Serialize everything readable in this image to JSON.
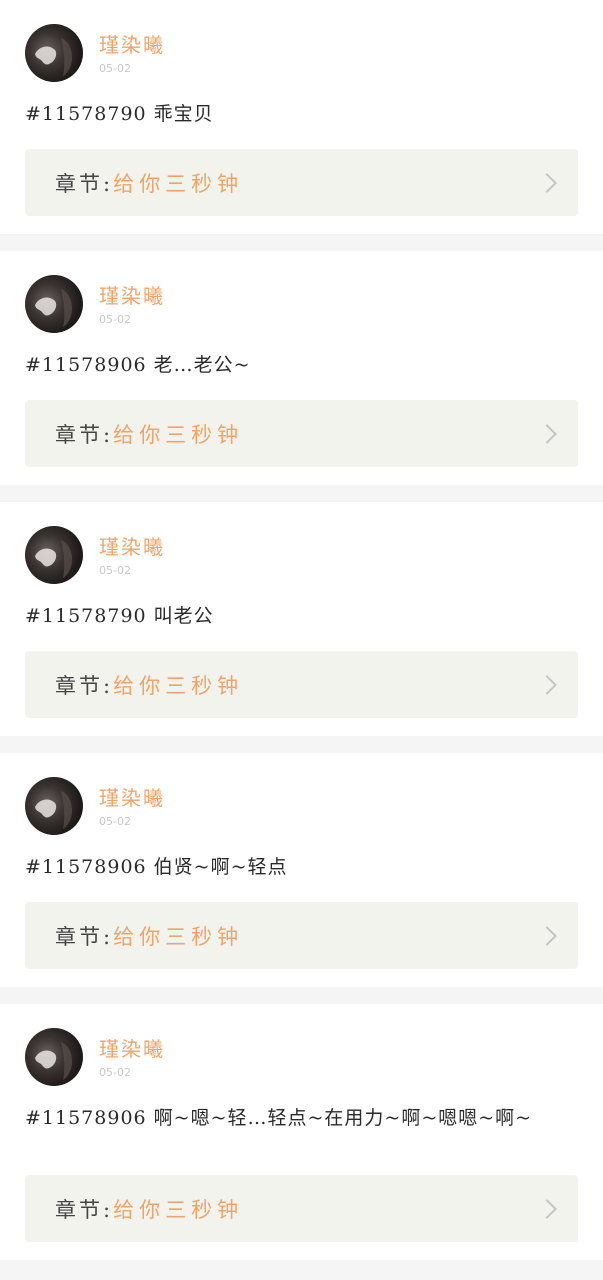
{
  "colors": {
    "accent": "#f0a46a",
    "chapter_bg": "#f3f3ee",
    "separator": "#f6f5f5"
  },
  "chapter_prefix": "章节:",
  "posts": [
    {
      "username": "瑾染曦",
      "date": "05-02",
      "content": "#11578790 乖宝贝",
      "chapter_title": "给你三秒钟"
    },
    {
      "username": "瑾染曦",
      "date": "05-02",
      "content": "#11578906 老…老公~",
      "chapter_title": "给你三秒钟"
    },
    {
      "username": "瑾染曦",
      "date": "05-02",
      "content": "#11578790 叫老公",
      "chapter_title": "给你三秒钟"
    },
    {
      "username": "瑾染曦",
      "date": "05-02",
      "content": "#11578906 伯贤~啊~轻点",
      "chapter_title": "给你三秒钟"
    },
    {
      "username": "瑾染曦",
      "date": "05-02",
      "content": "#11578906 啊~嗯~轻…轻点~在用力~啊~嗯嗯~啊~",
      "chapter_title": "给你三秒钟"
    }
  ]
}
